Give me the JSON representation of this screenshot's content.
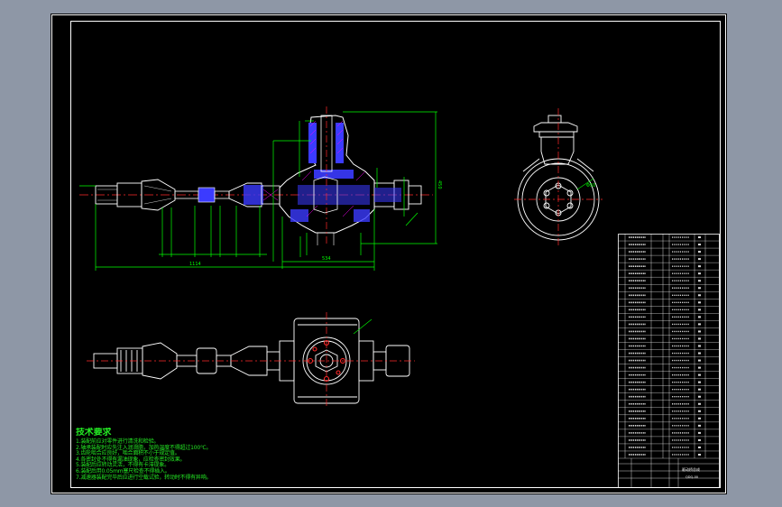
{
  "colors": {
    "workspace": "#8e97a6",
    "sheet": "#000000",
    "frame": "#ffffff",
    "geometry": "#ffffff",
    "dimension": "#00ff00",
    "centerline": "#ff2a2a",
    "section_fill": "#3b3bff",
    "hatch": "#ff00ff",
    "technical_notes": "#23e823"
  },
  "technical_requirements": {
    "title": "技术要求",
    "items": [
      "1.装配前应对零件进行清洗和检验。",
      "2.轴承装配时应先注入润滑脂，加热温度不得超过100℃。",
      "3.齿轮啮合应良好，啮合面积不小于规定值。",
      "4.各密封处不得有漏油现象，应检查密封效果。",
      "5.装配后应转动灵活，不得有卡滞现象。",
      "6.装配后用0.05mm塞尺检查不得插入。",
      "7.减速器装配完毕后应进行空载试验，转动时不得有异响。"
    ]
  },
  "dimensions": {
    "overall_length": "1114",
    "half_length": "534",
    "height": "450",
    "diameter_label": "Φ50"
  },
  "title_block": {
    "drawing_name": "驱动桥总成",
    "drawing_code": "QDQ-00",
    "scale": "1:2",
    "sheet": "共1张"
  }
}
